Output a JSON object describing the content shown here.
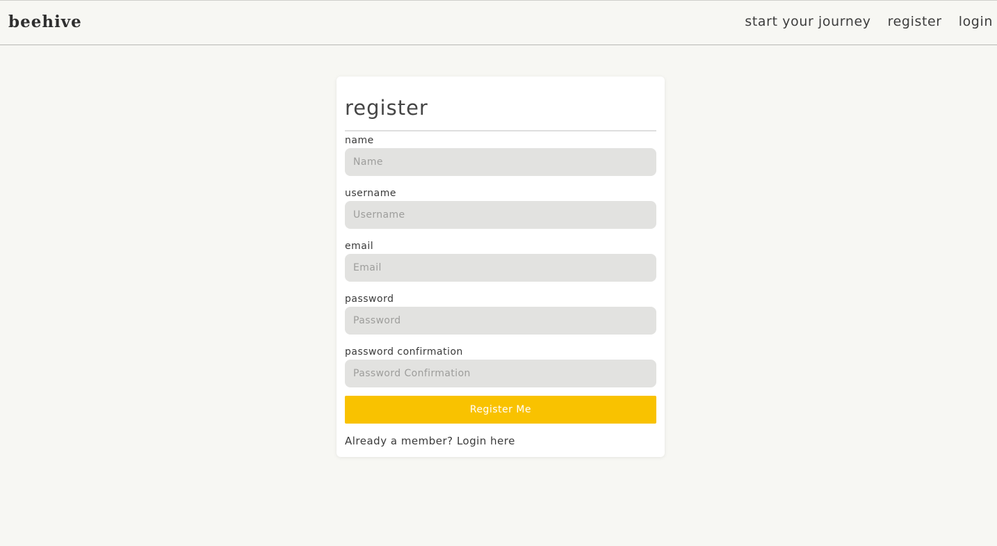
{
  "navbar": {
    "brand": "beehive",
    "links": [
      {
        "label": "start your journey"
      },
      {
        "label": "register"
      },
      {
        "label": "login"
      }
    ]
  },
  "form": {
    "title": "register",
    "fields": [
      {
        "label": "name",
        "placeholder": "Name",
        "value": ""
      },
      {
        "label": "username",
        "placeholder": "Username",
        "value": ""
      },
      {
        "label": "email",
        "placeholder": "Email",
        "value": ""
      },
      {
        "label": "password",
        "placeholder": "Password",
        "value": ""
      },
      {
        "label": "password confirmation",
        "placeholder": "Password Confirmation",
        "value": ""
      }
    ],
    "submit_label": "Register Me",
    "footer_prefix": "Already a member?",
    "footer_link": "Login here"
  },
  "colors": {
    "page_background": "#f7f7f3",
    "card_background": "#ffffff",
    "input_background": "#e2e2e0",
    "accent": "#f9c200"
  }
}
